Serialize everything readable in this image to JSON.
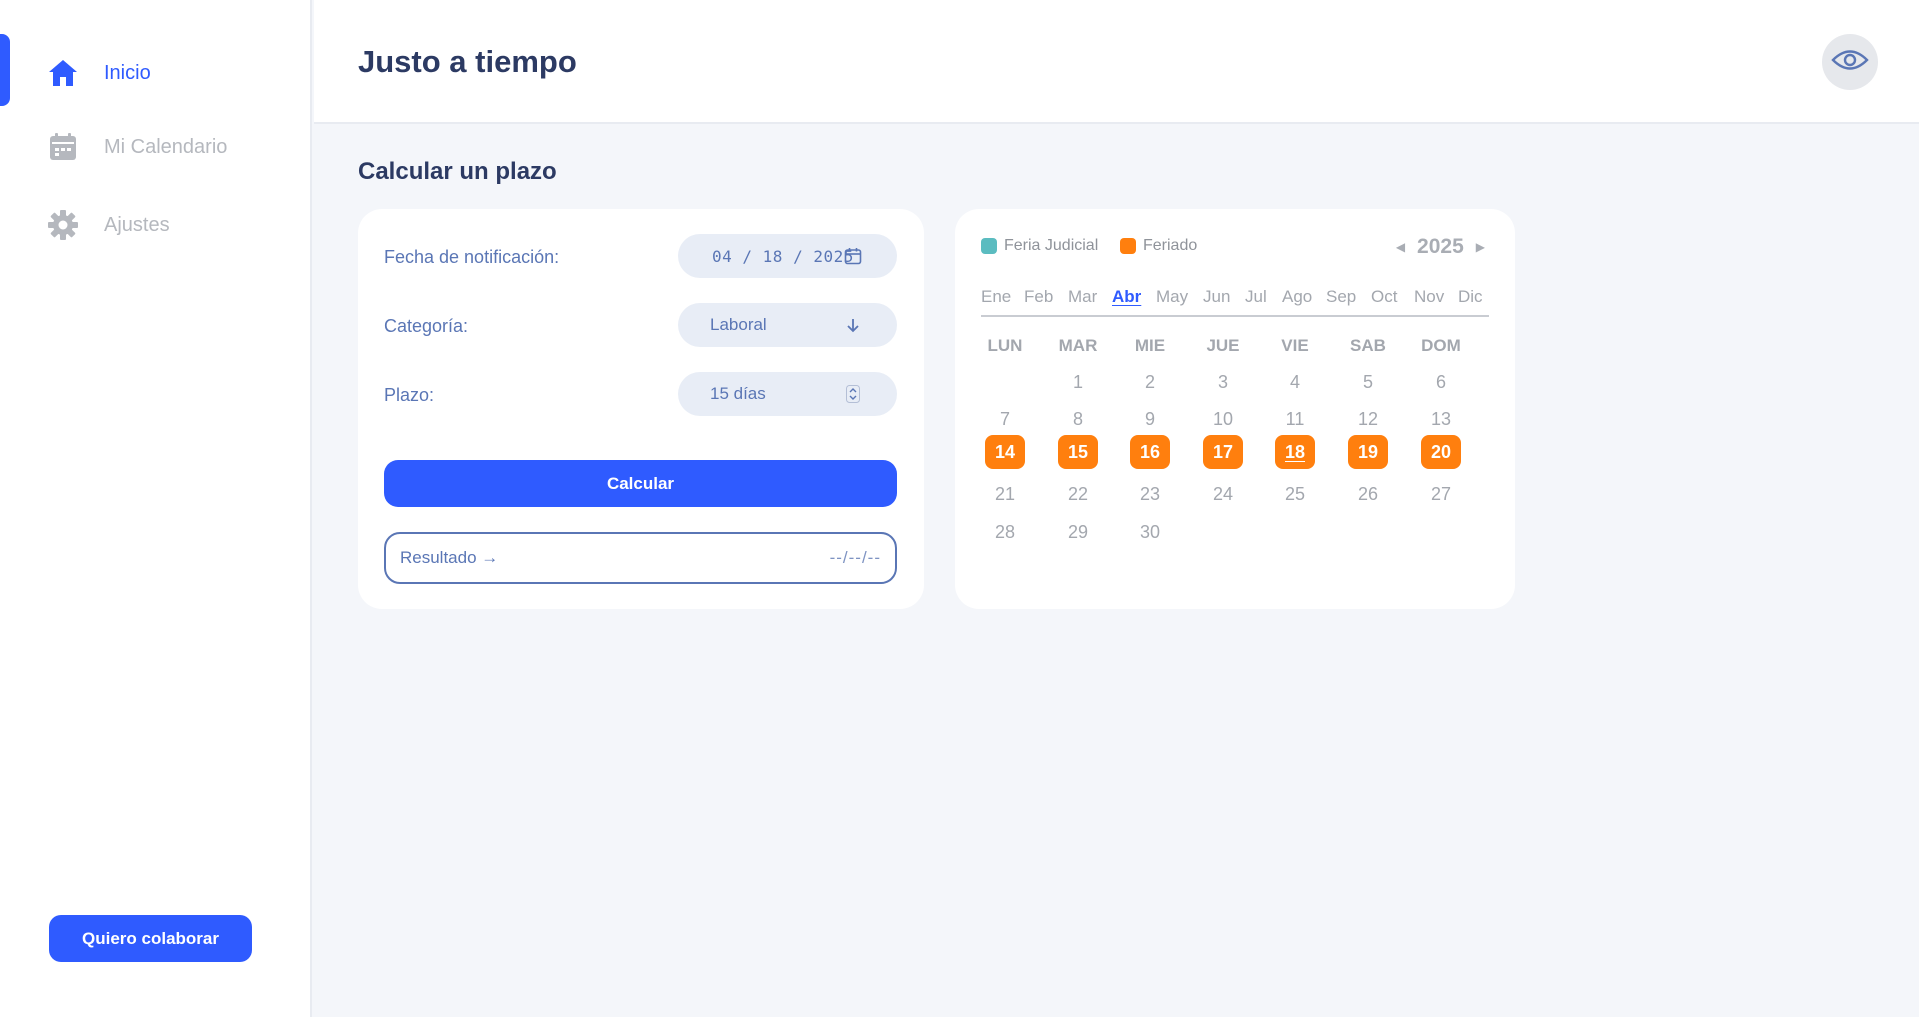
{
  "app": {
    "title": "Justo a tiempo"
  },
  "sidebar": {
    "items": [
      {
        "label": "Inicio",
        "icon": "home-icon",
        "active": true
      },
      {
        "label": "Mi Calendario",
        "icon": "calendar-icon",
        "active": false
      },
      {
        "label": "Ajustes",
        "icon": "gear-icon",
        "active": false
      }
    ],
    "collab_button": "Quiero colaborar"
  },
  "header": {
    "eye_button_icon": "eye-icon"
  },
  "main": {
    "section_title": "Calcular un plazo",
    "form": {
      "notification_date": {
        "label": "Fecha de notificación:",
        "value": "04 / 18 / 2025"
      },
      "category": {
        "label": "Categoría:",
        "value": "Laboral"
      },
      "term": {
        "label": "Plazo:",
        "value": "15 días"
      },
      "calculate_button": "Calcular",
      "result": {
        "label": "Resultado →",
        "value": "--/--/--"
      }
    },
    "calendar": {
      "legend": [
        {
          "label": "Feria Judicial",
          "color": "#5bbcc0"
        },
        {
          "label": "Feriado",
          "color": "#ff7f0e"
        }
      ],
      "year": "2025",
      "prev_arrow": "◀",
      "next_arrow": "▶",
      "months": [
        "Ene",
        "Feb",
        "Mar",
        "Abr",
        "May",
        "Jun",
        "Jul",
        "Ago",
        "Sep",
        "Oct",
        "Nov",
        "Dic"
      ],
      "active_month": "Abr",
      "weekdays": [
        "LUN",
        "MAR",
        "MIE",
        "JUE",
        "VIE",
        "SAB",
        "DOM"
      ],
      "weeks": [
        [
          "",
          "1",
          "2",
          "3",
          "4",
          "5",
          "6"
        ],
        [
          "7",
          "8",
          "9",
          "10",
          "11",
          "12",
          "13"
        ],
        [
          "14",
          "15",
          "16",
          "17",
          "18",
          "19",
          "20"
        ],
        [
          "21",
          "22",
          "23",
          "24",
          "25",
          "26",
          "27"
        ],
        [
          "28",
          "29",
          "30",
          "",
          "",
          "",
          ""
        ]
      ],
      "holidays": [
        "14",
        "15",
        "16",
        "17",
        "18",
        "19",
        "20"
      ],
      "today": "18"
    }
  }
}
